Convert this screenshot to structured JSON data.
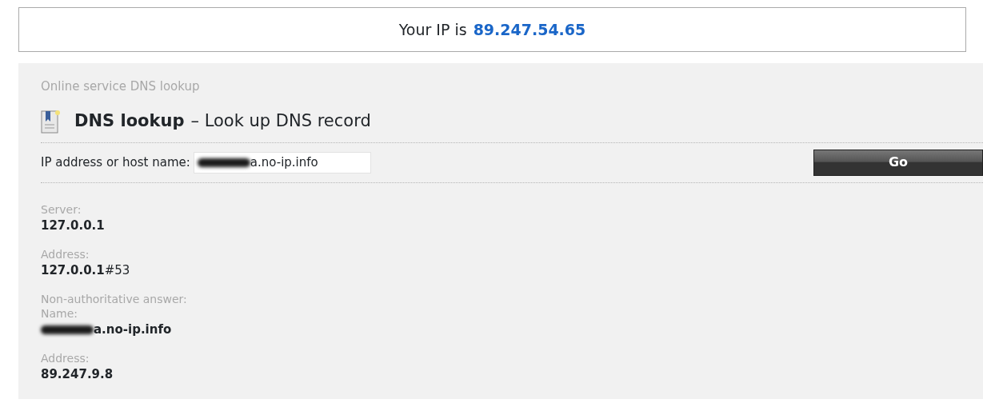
{
  "ip_banner": {
    "label": "Your IP is",
    "ip": "89.247.54.65"
  },
  "panel": {
    "breadcrumb": "Online service DNS lookup",
    "heading": {
      "title": "DNS lookup",
      "subtitle": "– Look up DNS record"
    },
    "form": {
      "label": "IP address or host name:",
      "value": "a.no-ip.info",
      "redacted": true,
      "button": "Go"
    },
    "results": [
      {
        "field": "Server:",
        "text": "127.0.0.1",
        "redacted": false
      },
      {
        "field": "Address:",
        "text": "**127.0.0.1**#53",
        "redacted": false
      }
    ],
    "answer": {
      "note": "Non-authoritative answer:",
      "records": [
        {
          "field": "Name:",
          "text": "a.no-ip.info",
          "redacted": true
        },
        {
          "field": "Address:",
          "text": "89.247.9.8",
          "redacted": false
        }
      ]
    }
  }
}
